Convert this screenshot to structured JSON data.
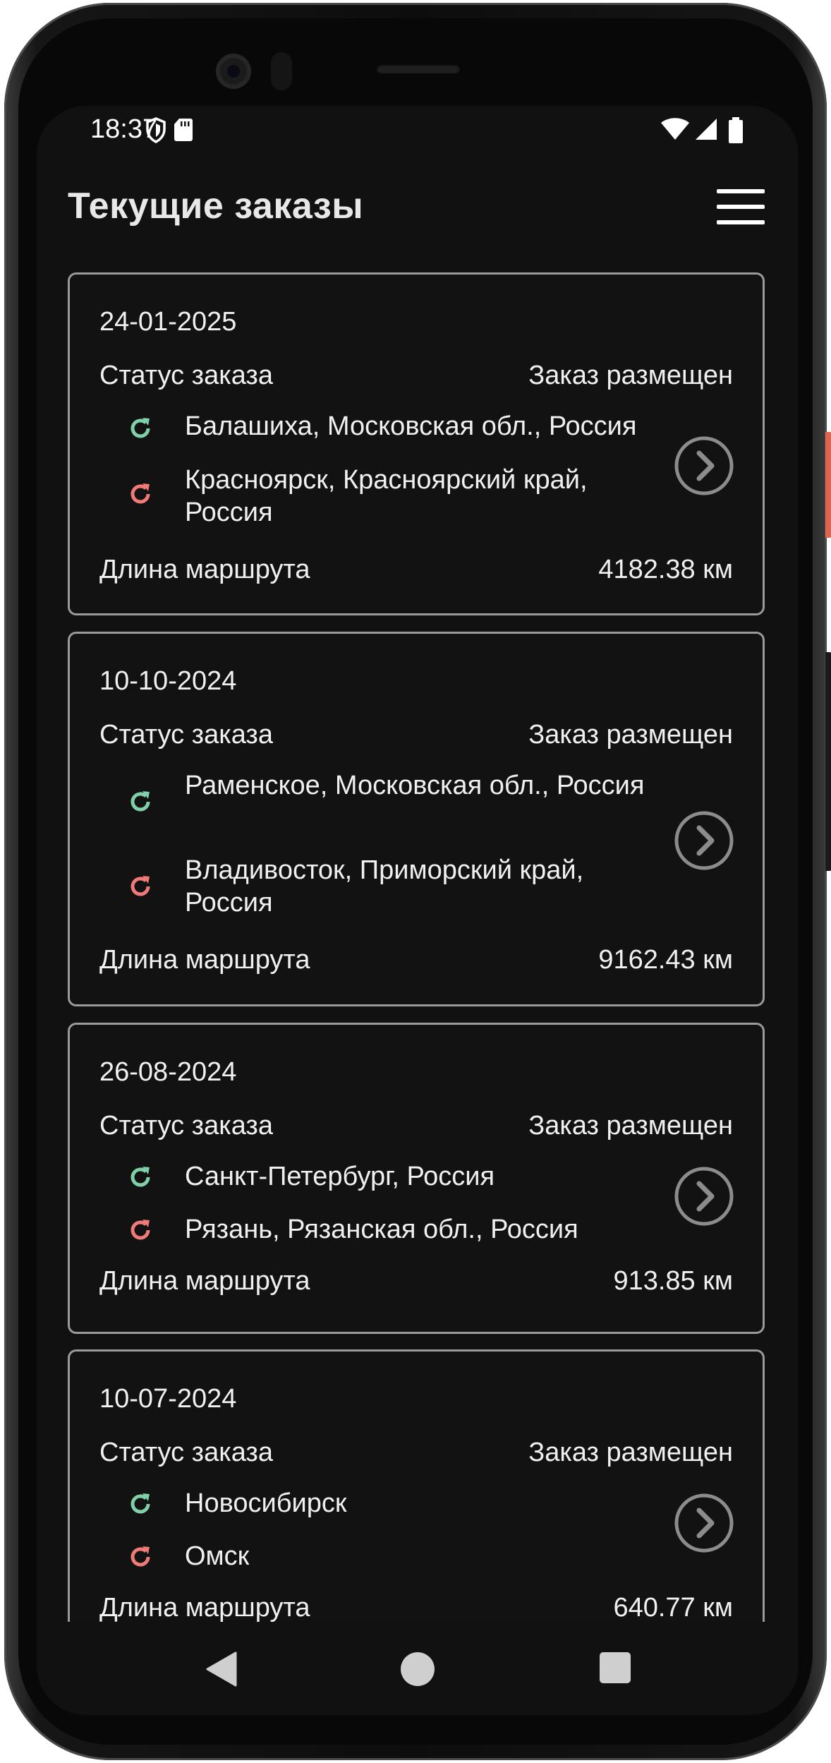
{
  "status_bar": {
    "time": "18:37"
  },
  "header": {
    "title": "Текущие заказы"
  },
  "orders": [
    {
      "date": "24-01-2025",
      "status_label": "Статус заказа",
      "status_value": "Заказ размещен",
      "from": "Балашиха, Московская обл., Россия",
      "to": "Красноярск, Красноярский край, Россия",
      "length_label": "Длина маршрута",
      "length_value": "4182.38 км"
    },
    {
      "date": "10-10-2024",
      "status_label": "Статус заказа",
      "status_value": "Заказ размещен",
      "from": "Раменское, Московская обл., Россия",
      "to": "Владивосток, Приморский край, Россия",
      "length_label": "Длина маршрута",
      "length_value": "9162.43 км"
    },
    {
      "date": "26-08-2024",
      "status_label": "Статус заказа",
      "status_value": "Заказ размещен",
      "from": "Санкт-Петербург, Россия",
      "to": "Рязань, Рязанская обл., Россия",
      "length_label": "Длина маршрута",
      "length_value": "913.85 км"
    },
    {
      "date": "10-07-2024",
      "status_label": "Статус заказа",
      "status_value": "Заказ размещен",
      "from": "Новосибирск",
      "to": "Омск",
      "length_label": "Длина маршрута",
      "length_value": "640.77 км"
    }
  ],
  "icons": {
    "origin": "refresh-green-icon",
    "destination": "refresh-red-icon",
    "open": "chevron-right-circle-icon",
    "menu": "hamburger-menu-icon",
    "back": "back-triangle-icon",
    "home": "home-circle-icon",
    "recents": "recents-square-icon"
  },
  "colors": {
    "background": "#111111",
    "card_border": "#9a9a9a",
    "origin_icon": "#7fd0a8",
    "destination_icon": "#f07a78",
    "text": "#f0f0f0"
  }
}
